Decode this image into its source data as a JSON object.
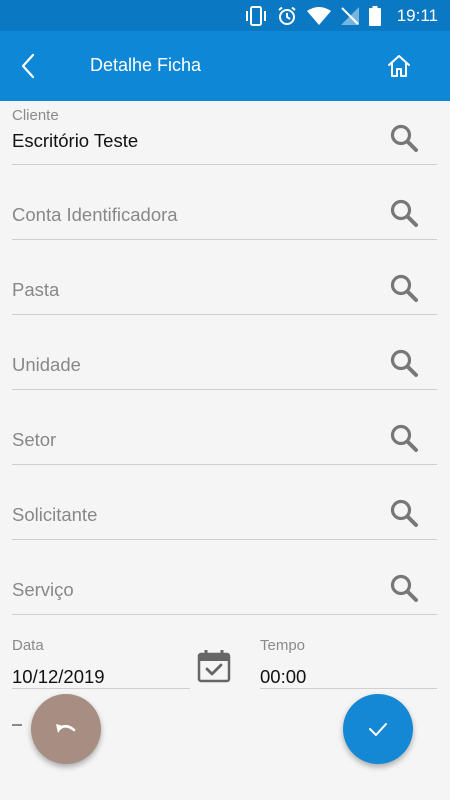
{
  "status_bar": {
    "time": "19:11",
    "icons": [
      "vibrate-icon",
      "alarm-icon",
      "wifi-icon",
      "no-signal-icon",
      "battery-icon"
    ]
  },
  "app_bar": {
    "title": "Detalhe Ficha",
    "back_icon": "chevron-left-icon",
    "home_icon": "home-icon"
  },
  "form": {
    "cliente": {
      "label": "Cliente",
      "value": "Escritório Teste"
    },
    "conta": {
      "placeholder": "Conta Identificadora"
    },
    "pasta": {
      "placeholder": "Pasta"
    },
    "unidade": {
      "placeholder": "Unidade"
    },
    "setor": {
      "placeholder": "Setor"
    },
    "solicitante": {
      "placeholder": "Solicitante"
    },
    "servico": {
      "placeholder": "Serviço"
    },
    "data": {
      "label": "Data",
      "value": "10/12/2019"
    },
    "tempo": {
      "label": "Tempo",
      "value": "00:00"
    }
  },
  "colors": {
    "primary": "#0e88d6",
    "status_bar": "#0a78c2",
    "fab_undo": "#a78d82",
    "fab_ok": "#1488d4"
  }
}
